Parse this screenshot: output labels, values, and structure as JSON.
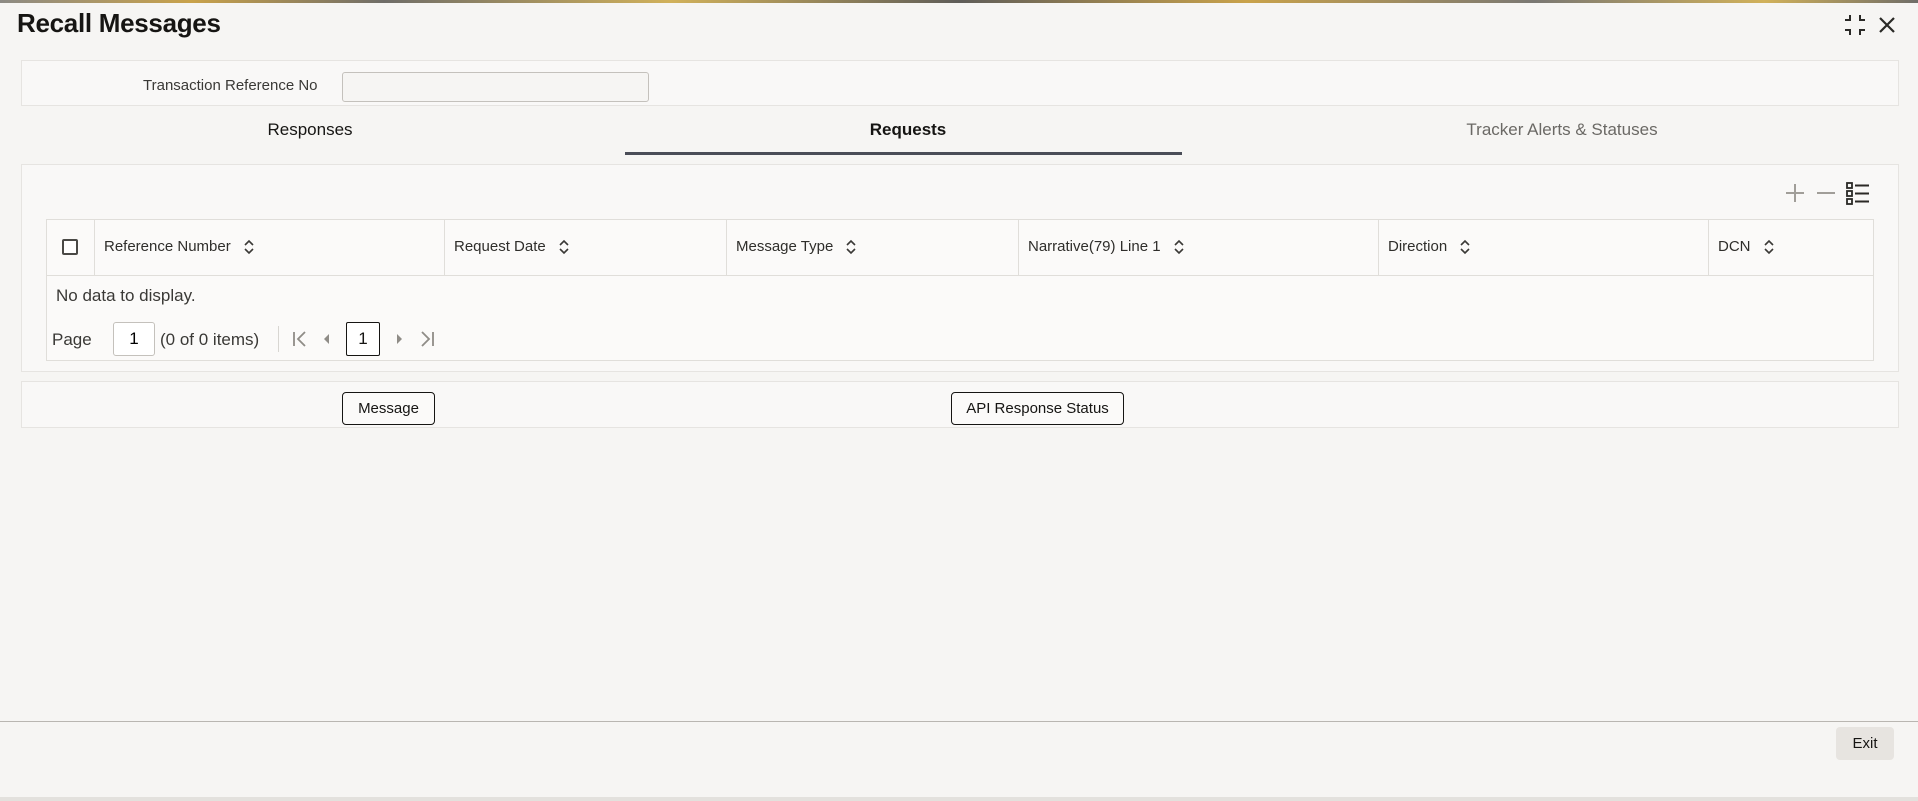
{
  "window": {
    "title": "Recall Messages"
  },
  "form": {
    "txn_ref_label": "Transaction Reference No",
    "txn_ref_value": ""
  },
  "tabs": [
    {
      "label": "Responses"
    },
    {
      "label": "Requests"
    },
    {
      "label": "Tracker Alerts & Statuses"
    }
  ],
  "active_tab": "Requests",
  "table": {
    "columns": [
      "Reference Number",
      "Request Date",
      "Message Type",
      "Narrative(79) Line 1",
      "Direction",
      "DCN"
    ],
    "empty_message": "No data to display.",
    "rows": []
  },
  "pagination": {
    "page_label": "Page",
    "page_value": "1",
    "items_summary": "(0 of 0 items)",
    "current_page": "1"
  },
  "actions": {
    "message_label": "Message",
    "api_status_label": "API Response Status",
    "exit_label": "Exit"
  },
  "icons": [
    "restore-icon",
    "close-icon",
    "add-row-icon",
    "delete-row-icon",
    "column-list-icon",
    "sort-icon",
    "first-page-icon",
    "prev-page-icon",
    "next-page-icon",
    "last-page-icon"
  ],
  "colors": {
    "active_tab_underline": "#4a4d57",
    "background": "#f6f5f3"
  }
}
